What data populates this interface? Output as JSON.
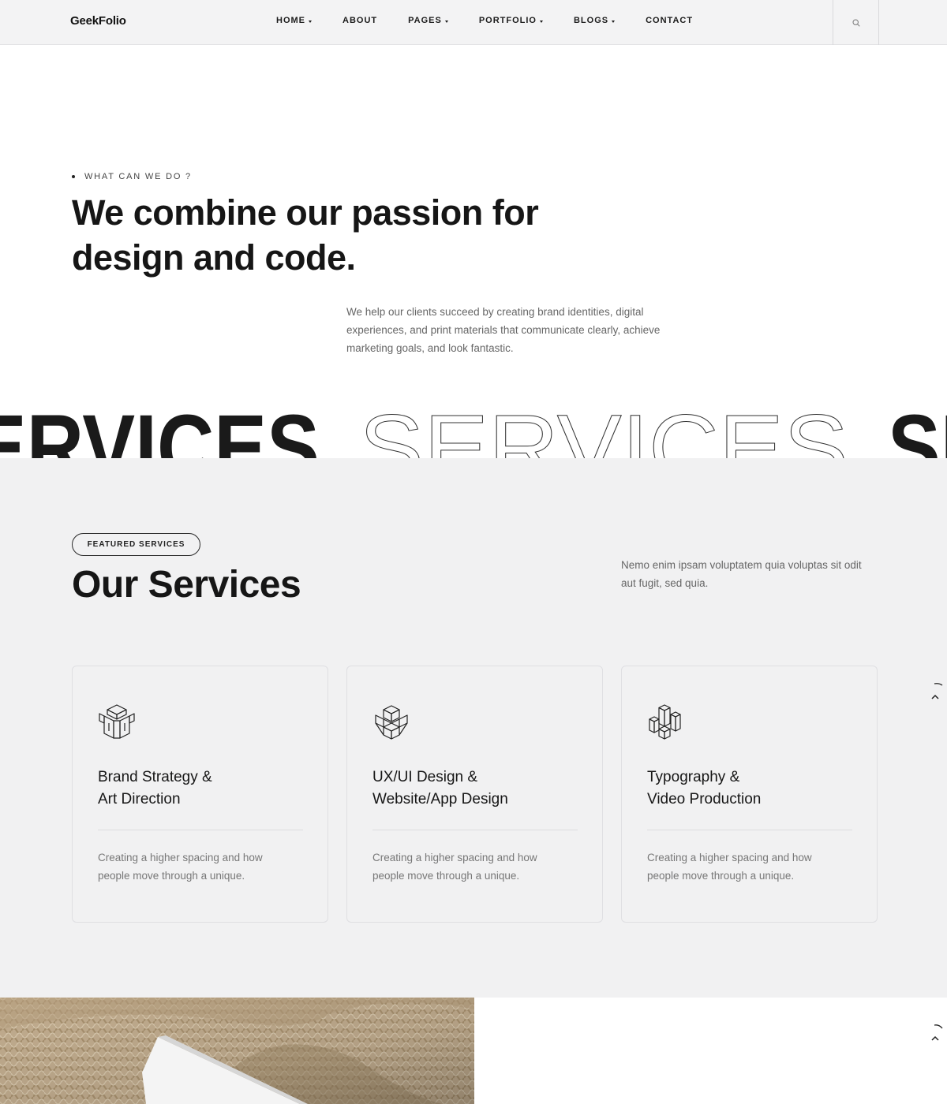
{
  "header": {
    "logo": "GeekFolio",
    "nav": [
      {
        "label": "HOME",
        "has_dropdown": true
      },
      {
        "label": "ABOUT",
        "has_dropdown": false
      },
      {
        "label": "PAGES",
        "has_dropdown": true
      },
      {
        "label": "PORTFOLIO",
        "has_dropdown": true
      },
      {
        "label": "BLOGS",
        "has_dropdown": true
      },
      {
        "label": "CONTACT",
        "has_dropdown": false
      }
    ],
    "search_icon": "search-icon"
  },
  "intro": {
    "eyebrow": "WHAT CAN WE DO ?",
    "headline_line1": "We combine our passion for",
    "headline_line2": "design and code.",
    "text": "We help our clients succeed by creating brand identities, digital experiences, and print materials that communicate clearly, achieve marketing goals, and look fantastic."
  },
  "marquee": {
    "word": "SERVICES"
  },
  "services": {
    "pill": "FEATURED SERVICES",
    "title": "Our Services",
    "description": "Nemo enim ipsam voluptatem quia voluptas sit odit aut fugit, sed quia.",
    "cards": [
      {
        "icon": "brand-cube-icon",
        "title_line1": "Brand Strategy &",
        "title_line2": "Art Direction",
        "text": "Creating a higher spacing and how people move through a unique."
      },
      {
        "icon": "uxui-cube-icon",
        "title_line1": "UX/UI Design &",
        "title_line2": "Website/App Design",
        "text": "Creating a higher spacing and how people move through a unique."
      },
      {
        "icon": "typography-blocks-icon",
        "title_line1": "Typography &",
        "title_line2": "Video Production",
        "text": "Creating a higher spacing and how people move through a unique."
      }
    ]
  },
  "colors": {
    "text_dark": "#161616",
    "text_muted": "#666666",
    "section_bg": "#f1f1f2",
    "header_bg": "#f3f3f4"
  }
}
